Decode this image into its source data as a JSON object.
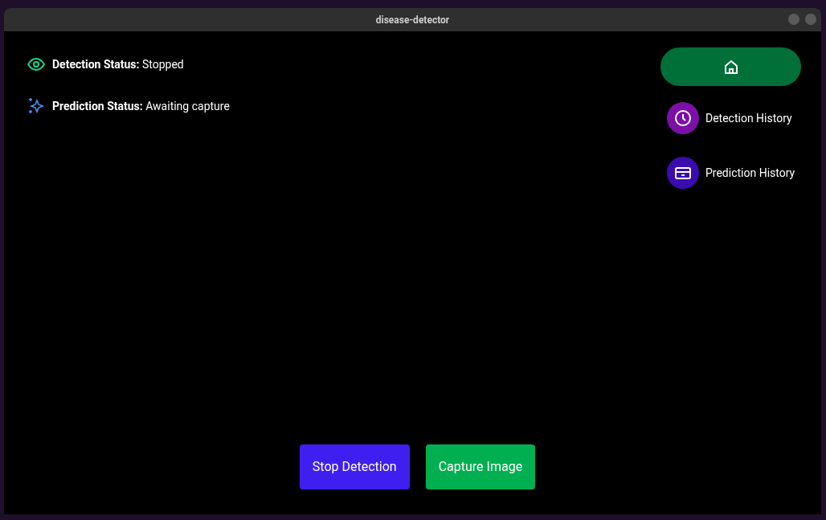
{
  "window": {
    "title": "disease-detector"
  },
  "statuses": [
    {
      "kind": "detection",
      "label": "Detection Status:",
      "value": "Stopped"
    },
    {
      "kind": "prediction",
      "label": "Prediction Status:",
      "value": "Awaiting capture"
    }
  ],
  "nav": {
    "home_selected": true,
    "items": [
      {
        "kind": "detection",
        "label": "Detection History",
        "color": "#7b0fa8"
      },
      {
        "kind": "prediction",
        "label": "Prediction History",
        "color": "#3a0cb0"
      }
    ]
  },
  "buttons": [
    {
      "kind": "stop",
      "label": "Stop Detection"
    },
    {
      "kind": "capture",
      "label": "Capture Image"
    }
  ]
}
